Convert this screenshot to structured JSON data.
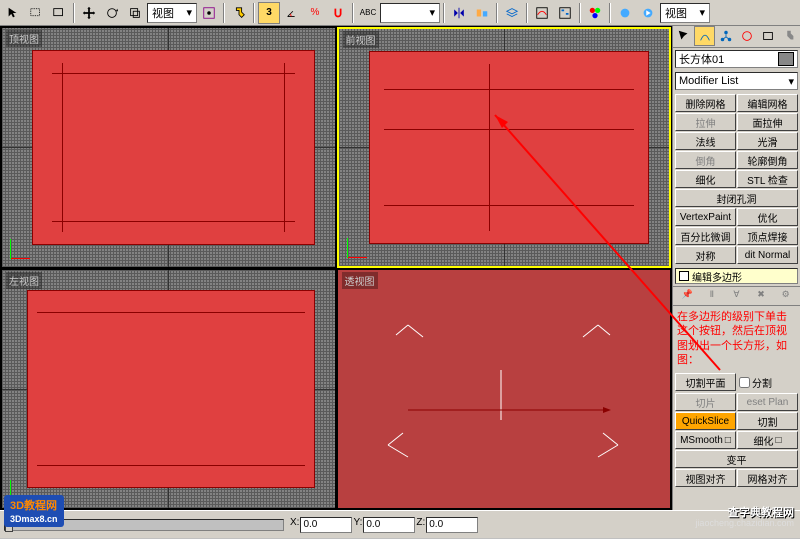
{
  "toolbar": {
    "view_dropdown": "视图",
    "view_dropdown2": "视图",
    "snap_angle": "3"
  },
  "viewports": {
    "top_label": "顶视图",
    "front_label": "前视图",
    "left_label": "左视图",
    "perspective_label": "透视图"
  },
  "sidepanel": {
    "object_name": "长方体01",
    "modifier_list": "Modifier List",
    "stack_item": "编辑多边形",
    "buttons": {
      "delete_mesh": "删除网格",
      "edit_mesh": "编辑网格",
      "extrude": "拉伸",
      "face_extrude": "面拉伸",
      "normal": "法线",
      "smooth": "光滑",
      "chamfer": "倒角",
      "outline_chamfer": "轮廓倒角",
      "tessellate": "细化",
      "stl_check": "STL 检查",
      "cap_holes": "封闭孔洞",
      "vertex_paint": "VertexPaint",
      "optimize": "优化",
      "percent_adjust": "百分比微调",
      "vert_weld": "顶点焊接",
      "symmetry": "对称",
      "edit_normal": "dit Normal",
      "slice_plane": "切割平面",
      "split": "分割",
      "slice": "切片",
      "reset_plane": "eset Plan",
      "quickslice": "QuickSlice",
      "cut": "切割",
      "msmooth": "MSmooth",
      "tessellate2": "细化",
      "make_planar": "变平",
      "view_align": "视图对齐",
      "grid_align": "网格对齐"
    },
    "annotation": "在多边形的级别下单击这个按钮，然后在顶视图划出一个长方形，如图："
  },
  "status": {
    "frame": "0",
    "x": "0.0",
    "y": "0.0",
    "z": "0.0"
  },
  "watermark": {
    "left_text": "3D教程网",
    "left_url": "3Dmax8.cn",
    "right_line1": "查字典教程网",
    "right_line2": "jiaocheng.chazidian.com"
  }
}
